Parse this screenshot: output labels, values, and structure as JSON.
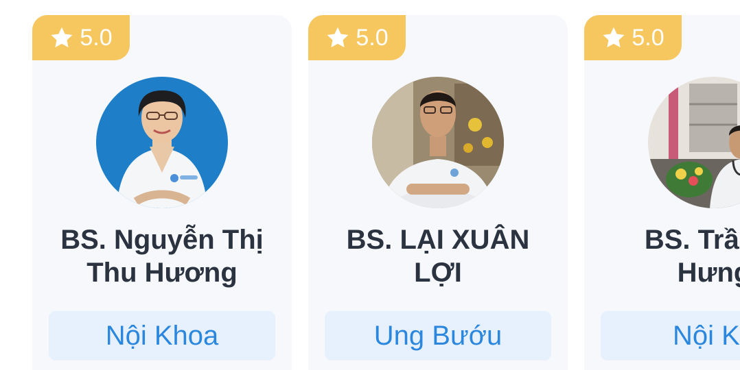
{
  "colors": {
    "rating_badge": "#f6c75f",
    "card_background": "#f6f8fb",
    "name_text": "#2b3340",
    "specialty_background": "#e6f1fd",
    "specialty_text": "#2b87de"
  },
  "doctors": [
    {
      "rating": "5.0",
      "rating_icon": "star-icon",
      "name_line1": "BS. Nguyễn Thị",
      "name_line2": "Thu Hương",
      "specialty": "Nội Khoa",
      "avatar": "doctor-photo"
    },
    {
      "rating": "5.0",
      "rating_icon": "star-icon",
      "name_line1": "BS. LẠI XUÂN",
      "name_line2": "LỢI",
      "specialty": "Ung Bướu",
      "avatar": "doctor-photo"
    },
    {
      "rating": "5.0",
      "rating_icon": "star-icon",
      "name_line1": "BS. Trần C",
      "name_line2": "Hưng",
      "specialty": "Nội Kh",
      "avatar": "doctor-photo"
    }
  ]
}
